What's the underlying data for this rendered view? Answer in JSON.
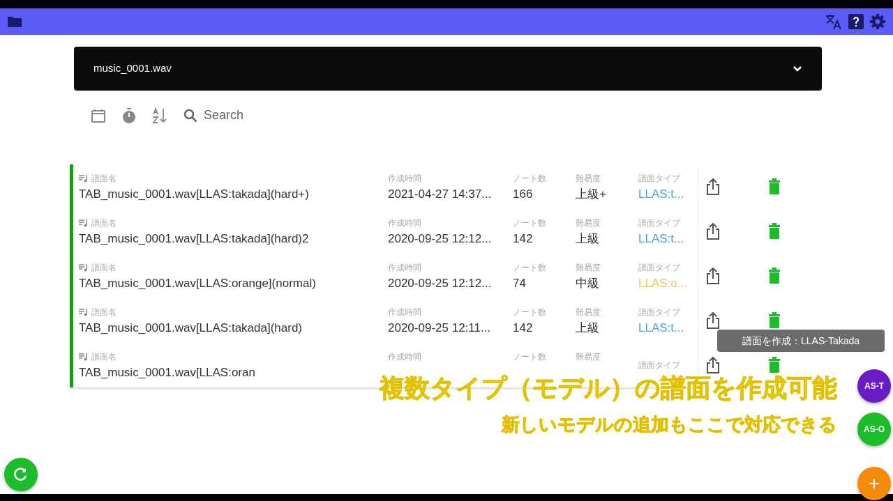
{
  "file_select": {
    "value": "music_0001.wav"
  },
  "toolbar": {
    "search_label": "Search"
  },
  "chart_list": {
    "rows": [
      {
        "name_label": "譜面名",
        "name": "TAB_music_0001.wav[LLAS:takada](hard+)",
        "created_label": "作成時間",
        "created": "2021-04-27 14:37...",
        "notes_label": "ノート数",
        "notes": "166",
        "difficulty_label": "難易度",
        "difficulty": "上級+",
        "type_label": "譜面タイプ",
        "type": "LLAS:t...",
        "color": "#4aa3df"
      },
      {
        "name_label": "譜面名",
        "name": "TAB_music_0001.wav[LLAS:takada](hard)2",
        "created_label": "作成時間",
        "created": "2020-09-25 12:12...",
        "notes_label": "ノート数",
        "notes": "142",
        "difficulty_label": "難易度",
        "difficulty": "上級",
        "type_label": "譜面タイプ",
        "type": "LLAS:t...",
        "color": "#4aa3df"
      },
      {
        "name_label": "譜面名",
        "name": "TAB_music_0001.wav[LLAS:orange](normal)",
        "created_label": "作成時間",
        "created": "2020-09-25 12:12...",
        "notes_label": "ノート数",
        "notes": "74",
        "difficulty_label": "難易度",
        "difficulty": "中級",
        "type_label": "譜面タイプ",
        "type": "LLAS:o...",
        "color": "#e6cc4a"
      },
      {
        "name_label": "譜面名",
        "name": "TAB_music_0001.wav[LLAS:takada](hard)",
        "created_label": "作成時間",
        "created": "2020-09-25 12:11...",
        "notes_label": "ノート数",
        "notes": "142",
        "difficulty_label": "難易度",
        "difficulty": "上級",
        "type_label": "譜面タイプ",
        "type": "LLAS:t...",
        "color": "#4aa3df"
      },
      {
        "name_label": "譜面名",
        "name": "TAB_music_0001.wav[LLAS:oran",
        "created_label": "作成時間",
        "notes_label": "ノート数",
        "difficulty_label": "難易度",
        "type_label": "譜面タイプ"
      }
    ]
  },
  "tooltip": "譜面を作成：LLAS-Takada",
  "fabs": [
    {
      "label": "AS-T",
      "color": "#6a1bc4"
    },
    {
      "label": "AS-O",
      "color": "#1cbd2a"
    },
    {
      "label": "+",
      "color": "#f58a0b"
    }
  ],
  "caption": {
    "line_1": "複数タイプ（モデル）の譜面を作成可能",
    "line_2": "新しいモデルの追加もここで対応できる"
  }
}
